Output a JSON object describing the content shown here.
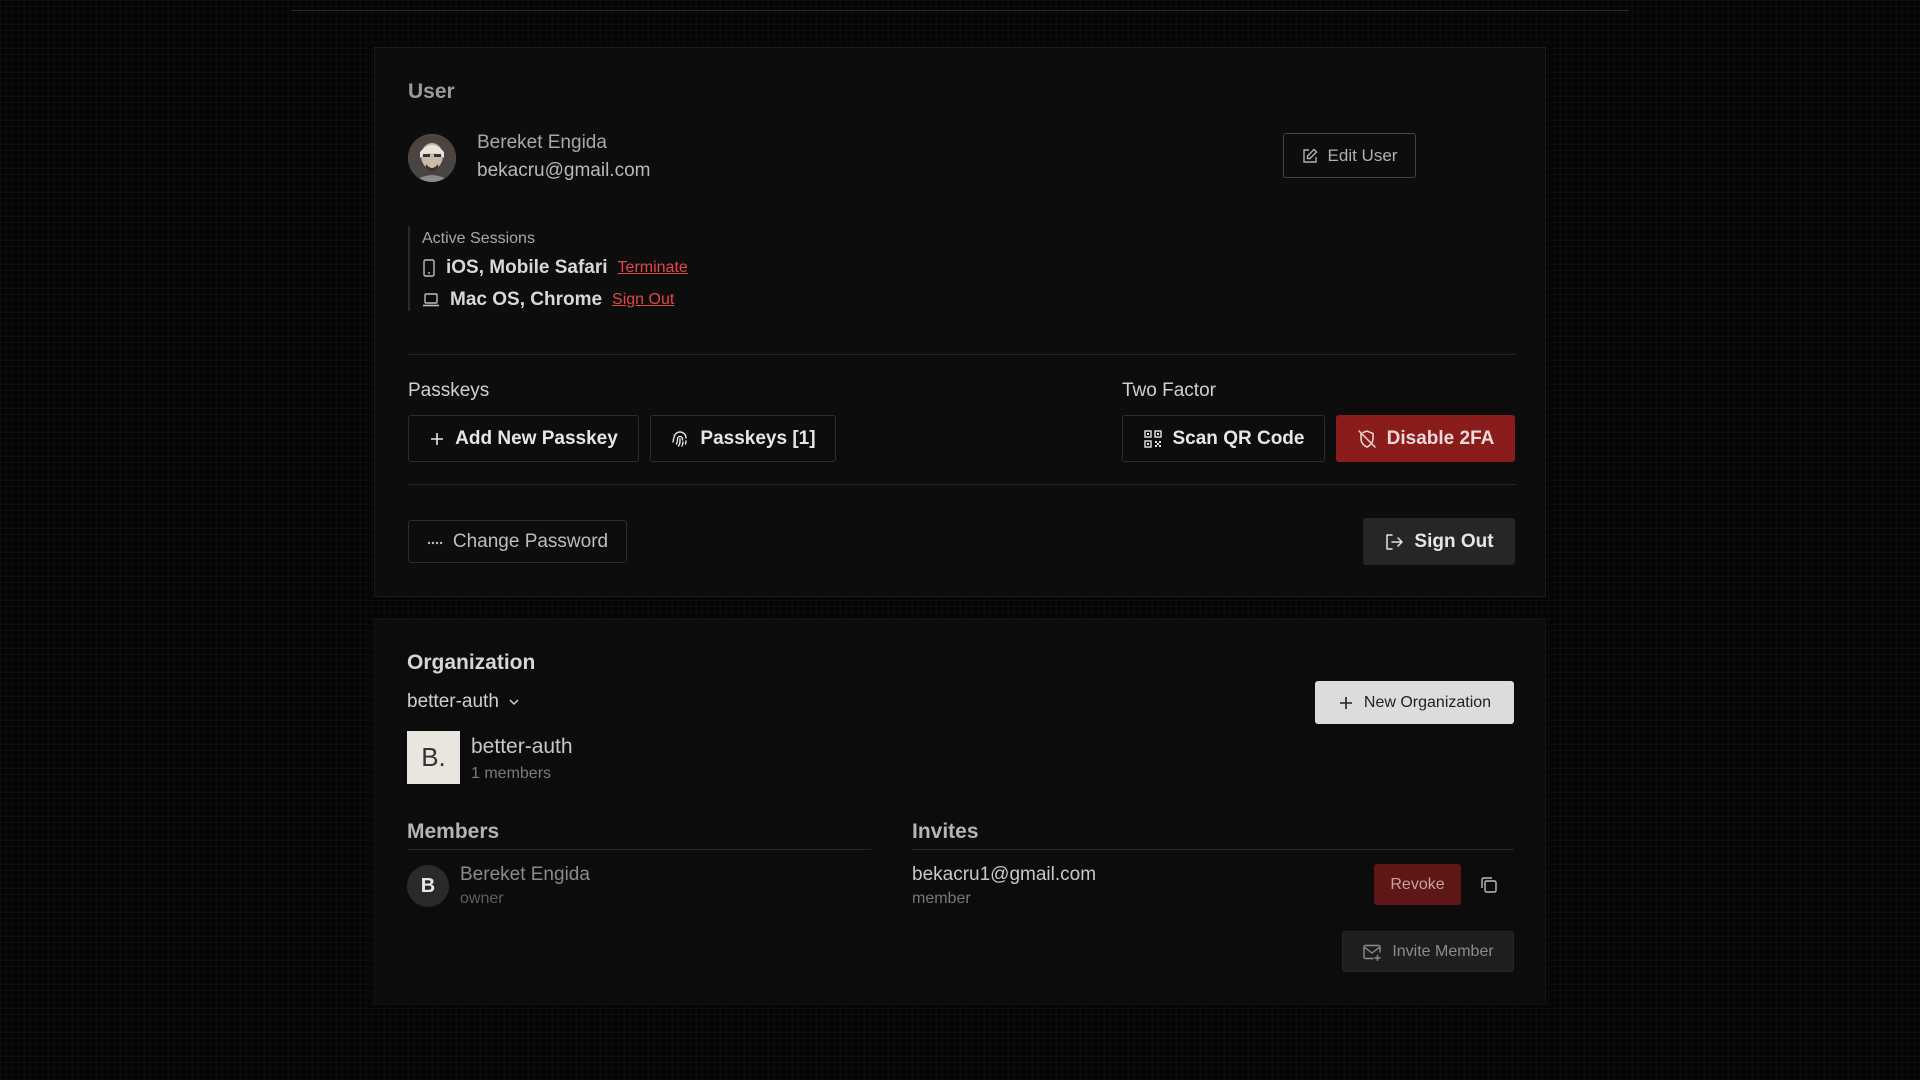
{
  "user_card": {
    "title": "User",
    "name": "Bereket Engida",
    "email": "bekacru@gmail.com",
    "edit_label": "Edit User",
    "sessions_label": "Active Sessions",
    "sessions": [
      {
        "device": "iOS, Mobile Safari",
        "action": "Terminate",
        "icon": "phone-icon"
      },
      {
        "device": "Mac OS, Chrome",
        "action": "Sign Out",
        "icon": "laptop-icon"
      }
    ],
    "passkeys_label": "Passkeys",
    "add_passkey_label": "Add New Passkey",
    "passkeys_button_label": "Passkeys [1]",
    "two_factor_label": "Two Factor",
    "scan_qr_label": "Scan QR Code",
    "disable_2fa_label": "Disable 2FA",
    "change_password_label": "Change Password",
    "sign_out_label": "Sign Out"
  },
  "org_card": {
    "title": "Organization",
    "selected_org": "better-auth",
    "new_org_label": "New Organization",
    "logo_text": "B.",
    "org_name": "better-auth",
    "member_count": "1 members",
    "members_title": "Members",
    "members": [
      {
        "initial": "B",
        "name": "Bereket Engida",
        "role": "owner"
      }
    ],
    "invites_title": "Invites",
    "invites": [
      {
        "email": "bekacru1@gmail.com",
        "role": "member",
        "revoke_label": "Revoke"
      }
    ],
    "invite_member_label": "Invite Member"
  },
  "colors": {
    "danger": "#8a1c1c",
    "link_danger": "#e04848",
    "background": "#050505",
    "card": "#0d0d0d"
  }
}
